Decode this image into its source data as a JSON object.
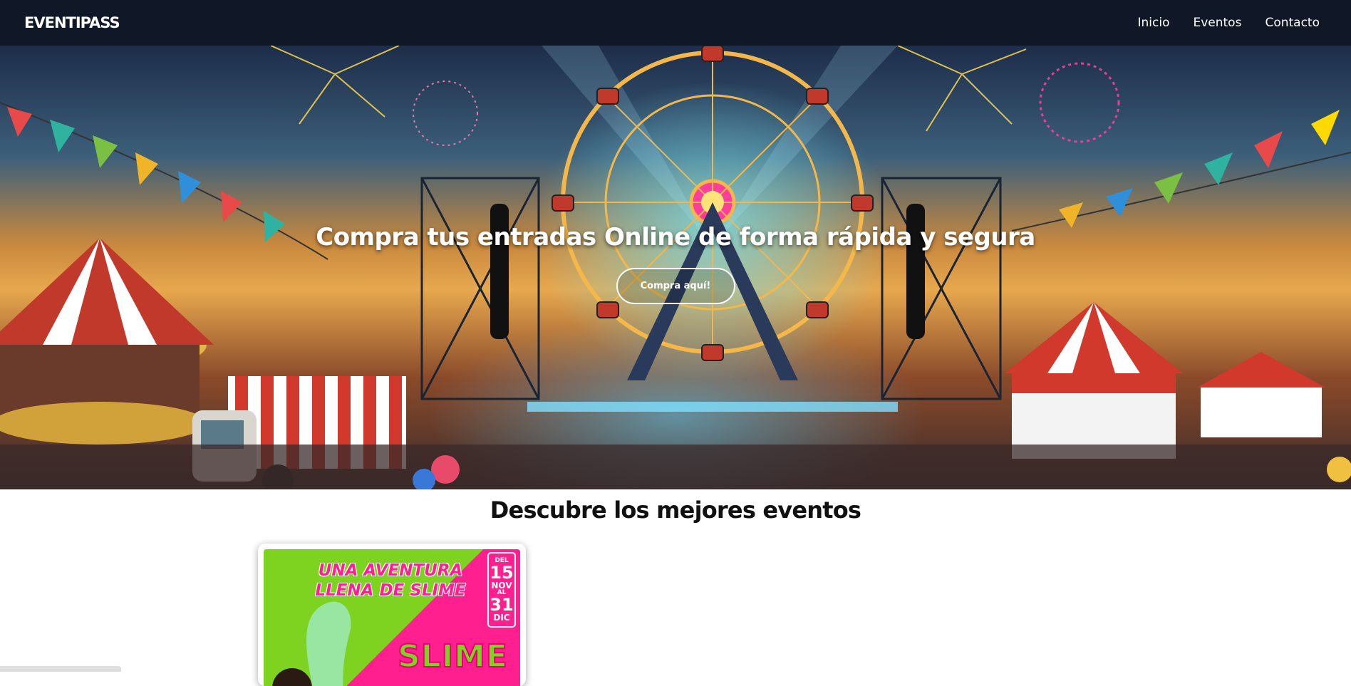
{
  "navbar": {
    "brand": "EVENTIPASS",
    "links": [
      {
        "label": "Inicio"
      },
      {
        "label": "Eventos"
      },
      {
        "label": "Contacto"
      }
    ]
  },
  "hero": {
    "title": "Compra tus entradas Online de forma rápida y segura",
    "button_label": "Compra aquí!",
    "background_image": "festival-ferris-wheel-fireworks"
  },
  "events": {
    "section_title": "Descubre los mejores eventos",
    "cards": [
      {
        "poster_title_line1": "UNA AVENTURA",
        "poster_title_line2": "LLENA DE SLIME",
        "date_from_label": "DEL",
        "date_from_day": "15",
        "date_from_month": "NOV",
        "date_to_label": "AL",
        "date_to_day": "31",
        "date_to_month": "DIC",
        "poster_word": "SLIME"
      }
    ]
  },
  "colors": {
    "navbar_bg": "#101828",
    "poster_green": "#7ed321",
    "poster_pink": "#ff1f8e"
  }
}
